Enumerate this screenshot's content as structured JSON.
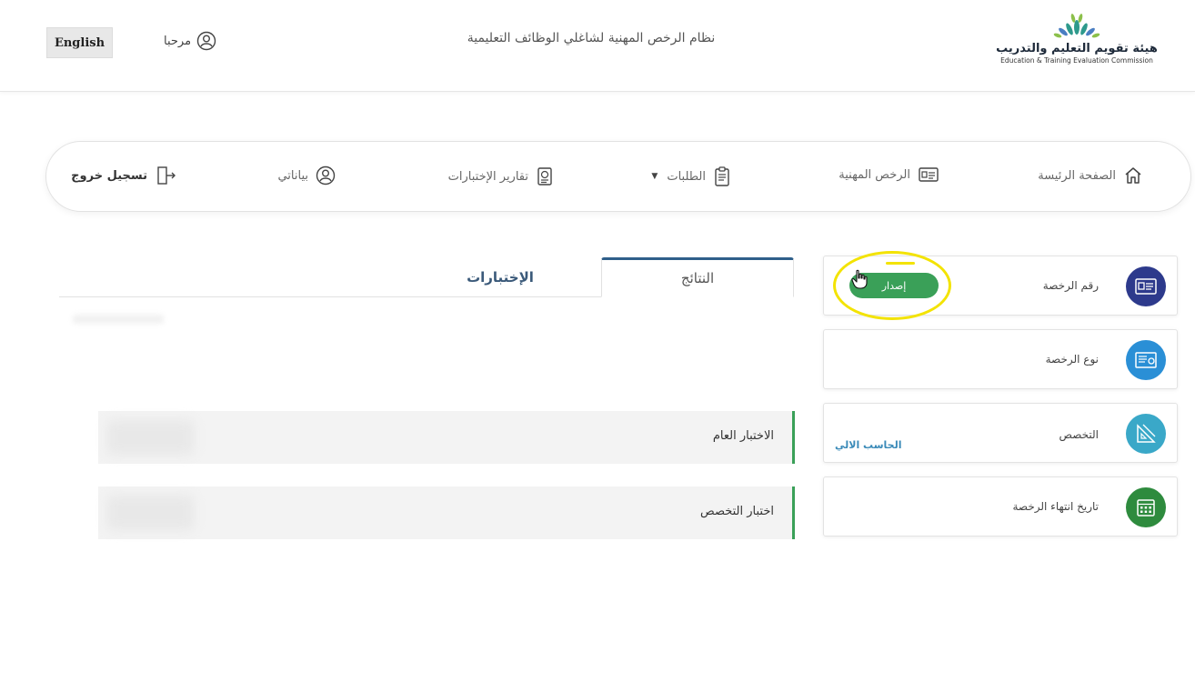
{
  "header": {
    "logo_ar": "هيئة تقويم التعليم والتدريب",
    "logo_en": "Education & Training Evaluation Commission",
    "system_title": "نظام الرخص المهنية لشاغلي الوظائف التعليمية",
    "welcome": "مرحبا",
    "language_button": "English"
  },
  "nav": {
    "home": "الصفحة الرئيسة",
    "licenses": "الرخص المهنية",
    "requests": "الطلبات",
    "test_reports": "تقارير الإختبارات",
    "my_data": "بياناتي",
    "logout": "تسجيل خروج"
  },
  "cards": {
    "license_number": {
      "label": "رقم الرخصة",
      "button": "إصدار",
      "icon": "id-card-icon",
      "color": "#2d3a8c"
    },
    "license_type": {
      "label": "نوع الرخصة",
      "icon": "certificate-icon",
      "color": "#2a8fd6"
    },
    "specialization": {
      "label": "التخصص",
      "value": "الحاسب الالي",
      "icon": "ruler-triangle-icon",
      "color": "#3aa8c8"
    },
    "expiry_date": {
      "label": "تاريخ انتهاء الرخصة",
      "icon": "calendar-icon",
      "color": "#2e8b3e"
    }
  },
  "tabs": {
    "results": "النتائج",
    "tests": "الإختبارات"
  },
  "results": {
    "general_test": "الاختبار العام",
    "specialization_test": "اختبار التخصص"
  },
  "colors": {
    "accent_green": "#3aa058",
    "highlight": "#f3e300",
    "tab_active_border": "#2f5f8a"
  }
}
